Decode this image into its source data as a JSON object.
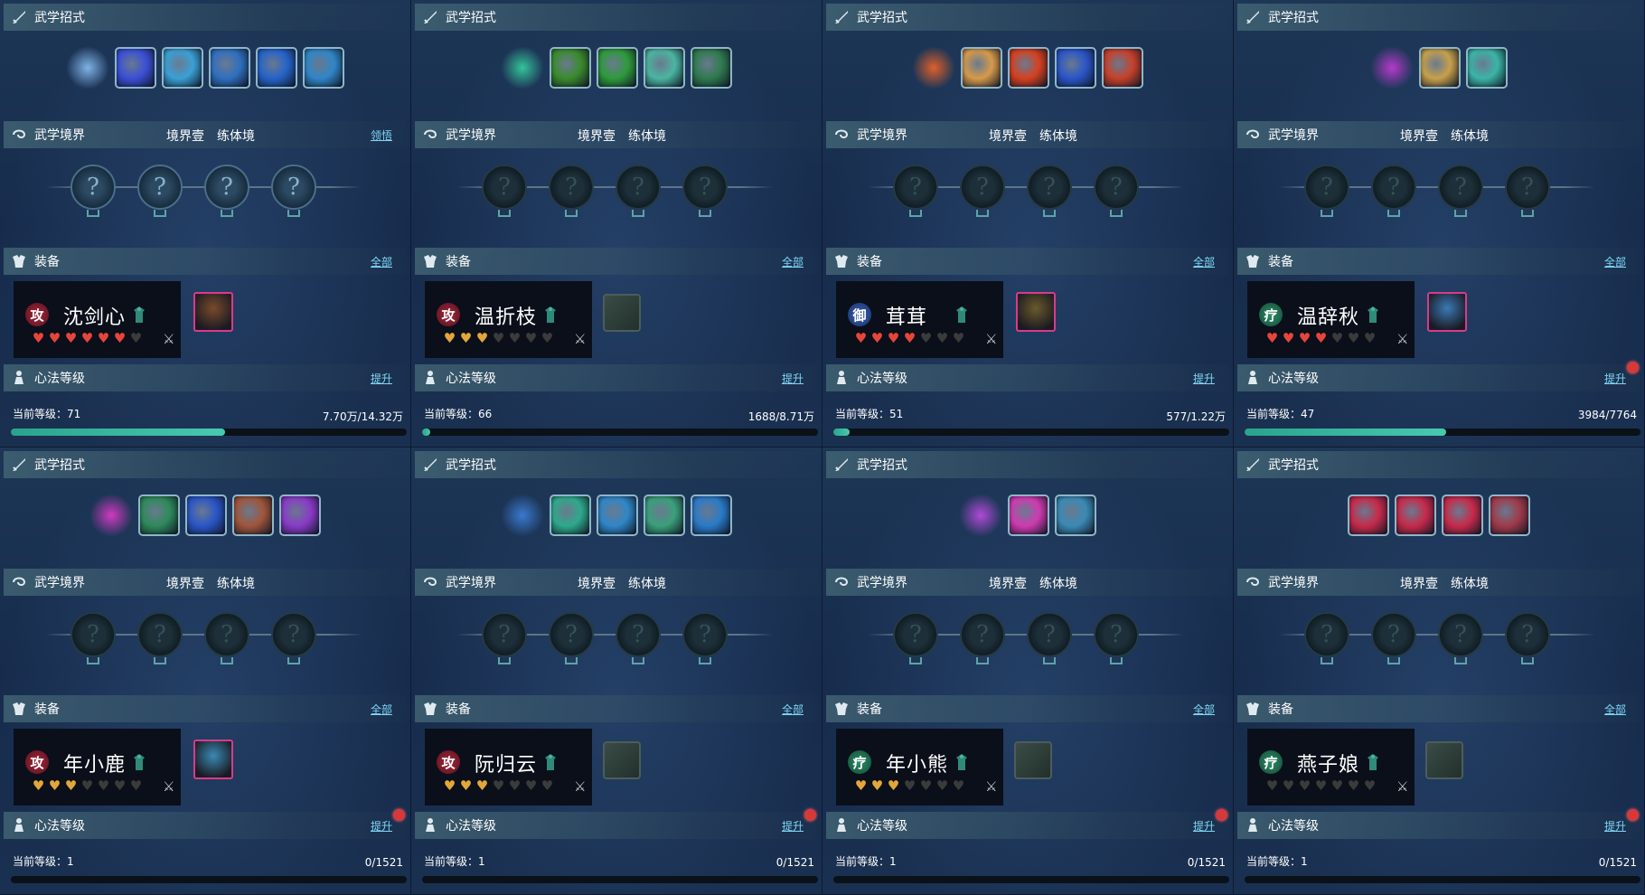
{
  "labels": {
    "skills": "武学招式",
    "realm": "武学境界",
    "realm_level": "境界壹",
    "realm_stage": "练体境",
    "equip": "装备",
    "equip_all": "全部",
    "heart": "心法等级",
    "heart_up": "提升",
    "comprehend": "领悟",
    "current_level": "当前等级："
  },
  "colors": {
    "heart_red": "#e8453a",
    "heart_gold": "#e2a73a",
    "bar": "#2aa38d",
    "link": "#7fd7f5",
    "notify_dot": "#d7383a"
  },
  "panels": [
    {
      "realm_action": "领悟",
      "skill_main_color": "#7fb3e8",
      "skill_colors": [
        "#3b4fd6",
        "#3aa0d6",
        "#2f6fbf",
        "#2563c9",
        "#2f86c7"
      ],
      "nodes_lit": [
        true,
        true,
        true,
        true
      ],
      "character": {
        "role": "攻",
        "role_class": "gong",
        "name": "沈剑心",
        "hearts_filled": 6,
        "heart_color": "red"
      },
      "equip": {
        "filled": true,
        "color": "#7a4a2a"
      },
      "level": "71",
      "exp": "7.70万/14.32万",
      "progress": 0.54,
      "notify": false
    },
    {
      "realm_action": "",
      "skill_main_color": "#35c49a",
      "skill_colors": [
        "#3a8b2c",
        "#2e9a3a",
        "#4bb5a0",
        "#2f7a4e"
      ],
      "nodes_lit": [
        false,
        false,
        false,
        false
      ],
      "character": {
        "role": "攻",
        "role_class": "gong",
        "name": "温折枝",
        "hearts_filled": 3,
        "heart_color": "gold"
      },
      "equip": {
        "filled": false,
        "color": ""
      },
      "level": "66",
      "exp": "1688/8.71万",
      "progress": 0.02,
      "notify": false
    },
    {
      "realm_action": "",
      "skill_main_color": "#e0602a",
      "skill_colors": [
        "#d79a4a",
        "#d6401f",
        "#2a55c7",
        "#c7402a"
      ],
      "nodes_lit": [
        false,
        false,
        false,
        false
      ],
      "character": {
        "role": "御",
        "role_class": "yu",
        "name": "茸茸",
        "hearts_filled": 4,
        "heart_color": "red"
      },
      "equip": {
        "filled": true,
        "color": "#6a5a2a"
      },
      "level": "51",
      "exp": "577/1.22万",
      "progress": 0.04,
      "notify": false
    },
    {
      "realm_action": "",
      "skill_main_color": "#b53ac9",
      "skill_colors": [
        "#c7a04a",
        "#3ab5a6"
      ],
      "nodes_lit": [
        false,
        false,
        false,
        false
      ],
      "character": {
        "role": "疗",
        "role_class": "liao",
        "name": "温辞秋",
        "hearts_filled": 4,
        "heart_color": "red"
      },
      "equip": {
        "filled": true,
        "color": "#3a7ab5"
      },
      "level": "47",
      "exp": "3984/7764",
      "progress": 0.51,
      "notify": true
    },
    {
      "realm_action": "",
      "skill_main_color": "#d03ac0",
      "skill_colors": [
        "#2e8a5a",
        "#2a55c7",
        "#a0553a",
        "#8a3ac7"
      ],
      "nodes_lit": [
        false,
        false,
        false,
        false
      ],
      "character": {
        "role": "攻",
        "role_class": "gong",
        "name": "年小鹿",
        "hearts_filled": 3,
        "heart_color": "gold"
      },
      "equip": {
        "filled": true,
        "color": "#3a8ab5"
      },
      "level": "1",
      "exp": "0/1521",
      "progress": 0,
      "notify": true
    },
    {
      "realm_action": "",
      "skill_main_color": "#3a7ad0",
      "skill_colors": [
        "#2eaa8a",
        "#2f86c7",
        "#3aa07a",
        "#2a7ac7"
      ],
      "nodes_lit": [
        false,
        false,
        false,
        false
      ],
      "character": {
        "role": "攻",
        "role_class": "gong",
        "name": "阮归云",
        "hearts_filled": 3,
        "heart_color": "gold"
      },
      "equip": {
        "filled": false,
        "color": ""
      },
      "level": "1",
      "exp": "0/1521",
      "progress": 0,
      "notify": true
    },
    {
      "realm_action": "",
      "skill_main_color": "#b04ad6",
      "skill_colors": [
        "#d03ab0",
        "#3a8ab5"
      ],
      "nodes_lit": [
        false,
        false,
        false,
        false
      ],
      "character": {
        "role": "疗",
        "role_class": "liao",
        "name": "年小熊",
        "hearts_filled": 3,
        "heart_color": "gold"
      },
      "equip": {
        "filled": false,
        "color": ""
      },
      "level": "1",
      "exp": "0/1521",
      "progress": 0,
      "notify": true
    },
    {
      "realm_action": "",
      "skill_main_color": "",
      "skill_colors": [
        "#c72a4a",
        "#c72a4a",
        "#c72a4a",
        "#a03a4a"
      ],
      "nodes_lit": [
        false,
        false,
        false,
        false
      ],
      "character": {
        "role": "疗",
        "role_class": "liao",
        "name": "燕子娘",
        "hearts_filled": 0,
        "heart_color": "gold"
      },
      "equip": {
        "filled": false,
        "color": ""
      },
      "level": "1",
      "exp": "0/1521",
      "progress": 0,
      "notify": true
    }
  ]
}
